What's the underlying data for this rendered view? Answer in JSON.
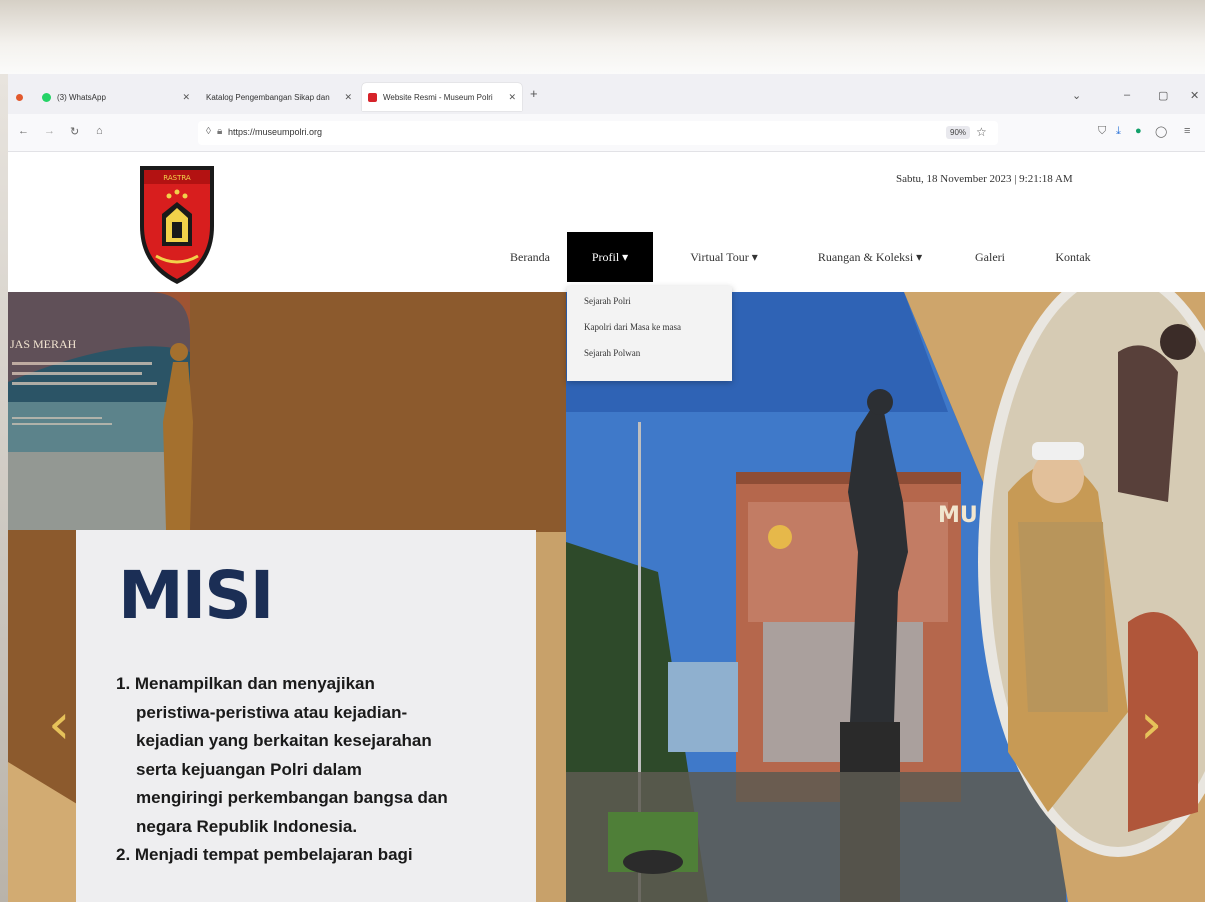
{
  "browser": {
    "tabs": [
      {
        "label": "(3) WhatsApp",
        "dot_color": "#25d366",
        "active": false
      },
      {
        "label": "Katalog Pengembangan Sikap dan",
        "active": false
      },
      {
        "label": "Website Resmi - Museum Polri",
        "dot_color": "#d6232a",
        "active": true
      }
    ],
    "new_tab": "+",
    "url": "https://museumpolri.org",
    "zoom": "90%"
  },
  "site": {
    "datetime": "Sabtu, 18 November 2023 | 9:21:18 AM",
    "menu": [
      {
        "label": "Beranda"
      },
      {
        "label": "Profil ▾",
        "active": true
      },
      {
        "label": "Virtual Tour ▾"
      },
      {
        "label": "Ruangan & Koleksi ▾"
      },
      {
        "label": "Galeri"
      },
      {
        "label": "Kontak"
      }
    ],
    "dropdown": [
      "Sejarah Polri",
      "Kapolri dari Masa ke masa",
      "Sejarah Polwan"
    ]
  },
  "hero": {
    "poster_title": "JAS MERAH",
    "misi_title": "MISI",
    "misi_lines": [
      "1. Menampilkan dan menyajikan",
      "peristiwa-peristiwa atau kejadian-",
      "kejadian yang berkaitan kesejarahan",
      "serta kejuangan Polri dalam",
      "mengiringi perkembangan bangsa dan",
      "negara Republik Indonesia.",
      "2. Menjadi   tempat   pembelajaran   bagi"
    ],
    "building_text": "MU",
    "prev_arrow": "‹",
    "next_arrow": "›"
  },
  "colors": {
    "hero_brown": "#8c5a2d",
    "hero_tan": "#c8a16a",
    "misi_navy": "#1b2e55",
    "arrow_yellow": "#e6c25a"
  }
}
